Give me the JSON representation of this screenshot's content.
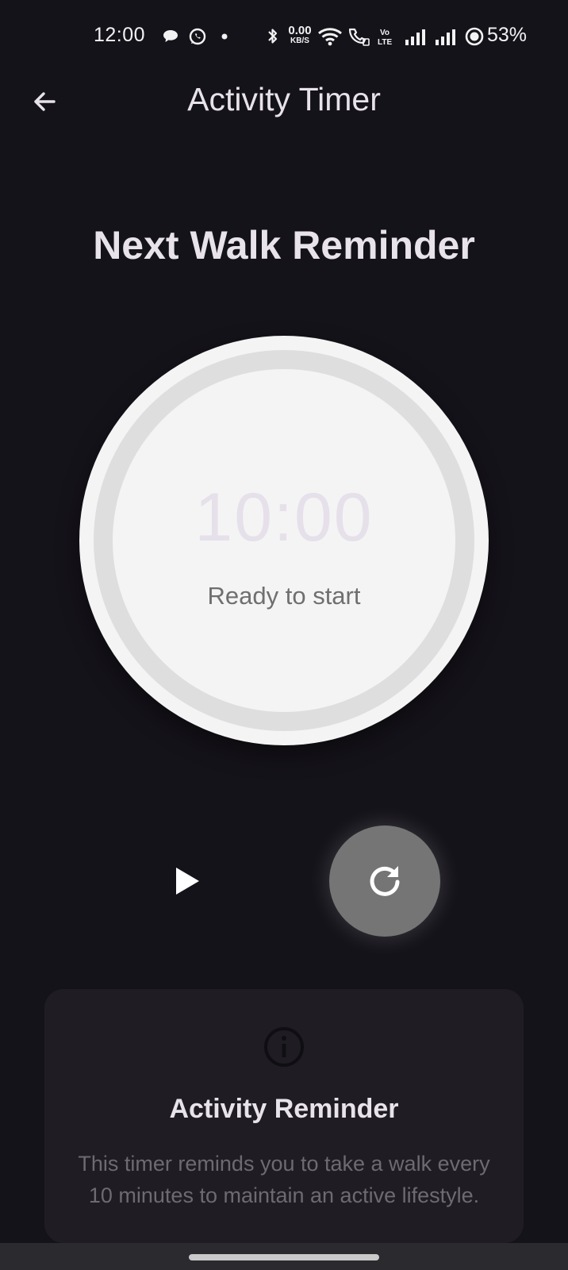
{
  "status_bar": {
    "time": "12:00",
    "net_speed_value": "0.00",
    "net_speed_unit": "KB/S",
    "volte": "Vo",
    "lte": "LTE",
    "battery_percent": "53%",
    "icons": [
      "chat-bubble-icon",
      "whatsapp-icon",
      "dot-icon",
      "bluetooth-icon",
      "wifi-icon",
      "wifi-calling-icon",
      "volte-icon",
      "signal-icon",
      "signal-icon",
      "battery-saver-icon"
    ]
  },
  "app_bar": {
    "title": "Activity Timer",
    "back_icon": "arrow-left-icon"
  },
  "heading": "Next Walk Reminder",
  "timer": {
    "time": "10:00",
    "status": "Ready to start",
    "progress": 0
  },
  "controls": {
    "play_icon": "play-icon",
    "reset_icon": "refresh-icon"
  },
  "info_card": {
    "icon": "info-icon",
    "title": "Activity Reminder",
    "body": "This timer reminds you to take a walk every 10 minutes to maintain an active lifestyle."
  },
  "colors": {
    "background": "#15131a",
    "circle": "#f4f4f4",
    "ring": "#dedede",
    "reset_button": "#757575",
    "card": "#1f1d23"
  }
}
